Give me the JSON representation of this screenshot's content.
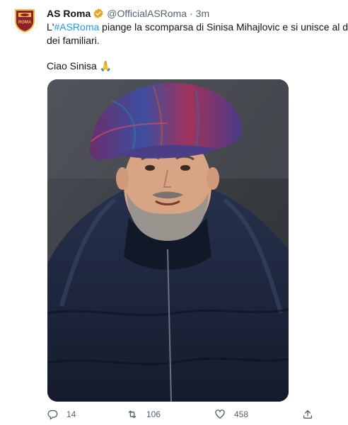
{
  "tweet": {
    "author_name": "AS Roma",
    "handle": "@OfficialASRoma",
    "separator": "·",
    "time": "3m",
    "text_before": "L'",
    "hashtag": "#ASRoma",
    "text_after": " piange la scomparsa di Sinisa Mihajlovic e si unisce al dolore",
    "text_line2": "dei familiari.",
    "closing": "Ciao Sinisa 🙏"
  },
  "actions": {
    "replies": "14",
    "retweets": "106",
    "likes": "458"
  },
  "colors": {
    "link": "#1d9bf0",
    "secondary": "#536471",
    "verified_badge": "#e8a317",
    "roma_red": "#8e1f2f",
    "roma_gold": "#f0bc42"
  },
  "icons": [
    "verified-badge-icon",
    "reply-icon",
    "retweet-icon",
    "like-icon",
    "share-icon"
  ]
}
